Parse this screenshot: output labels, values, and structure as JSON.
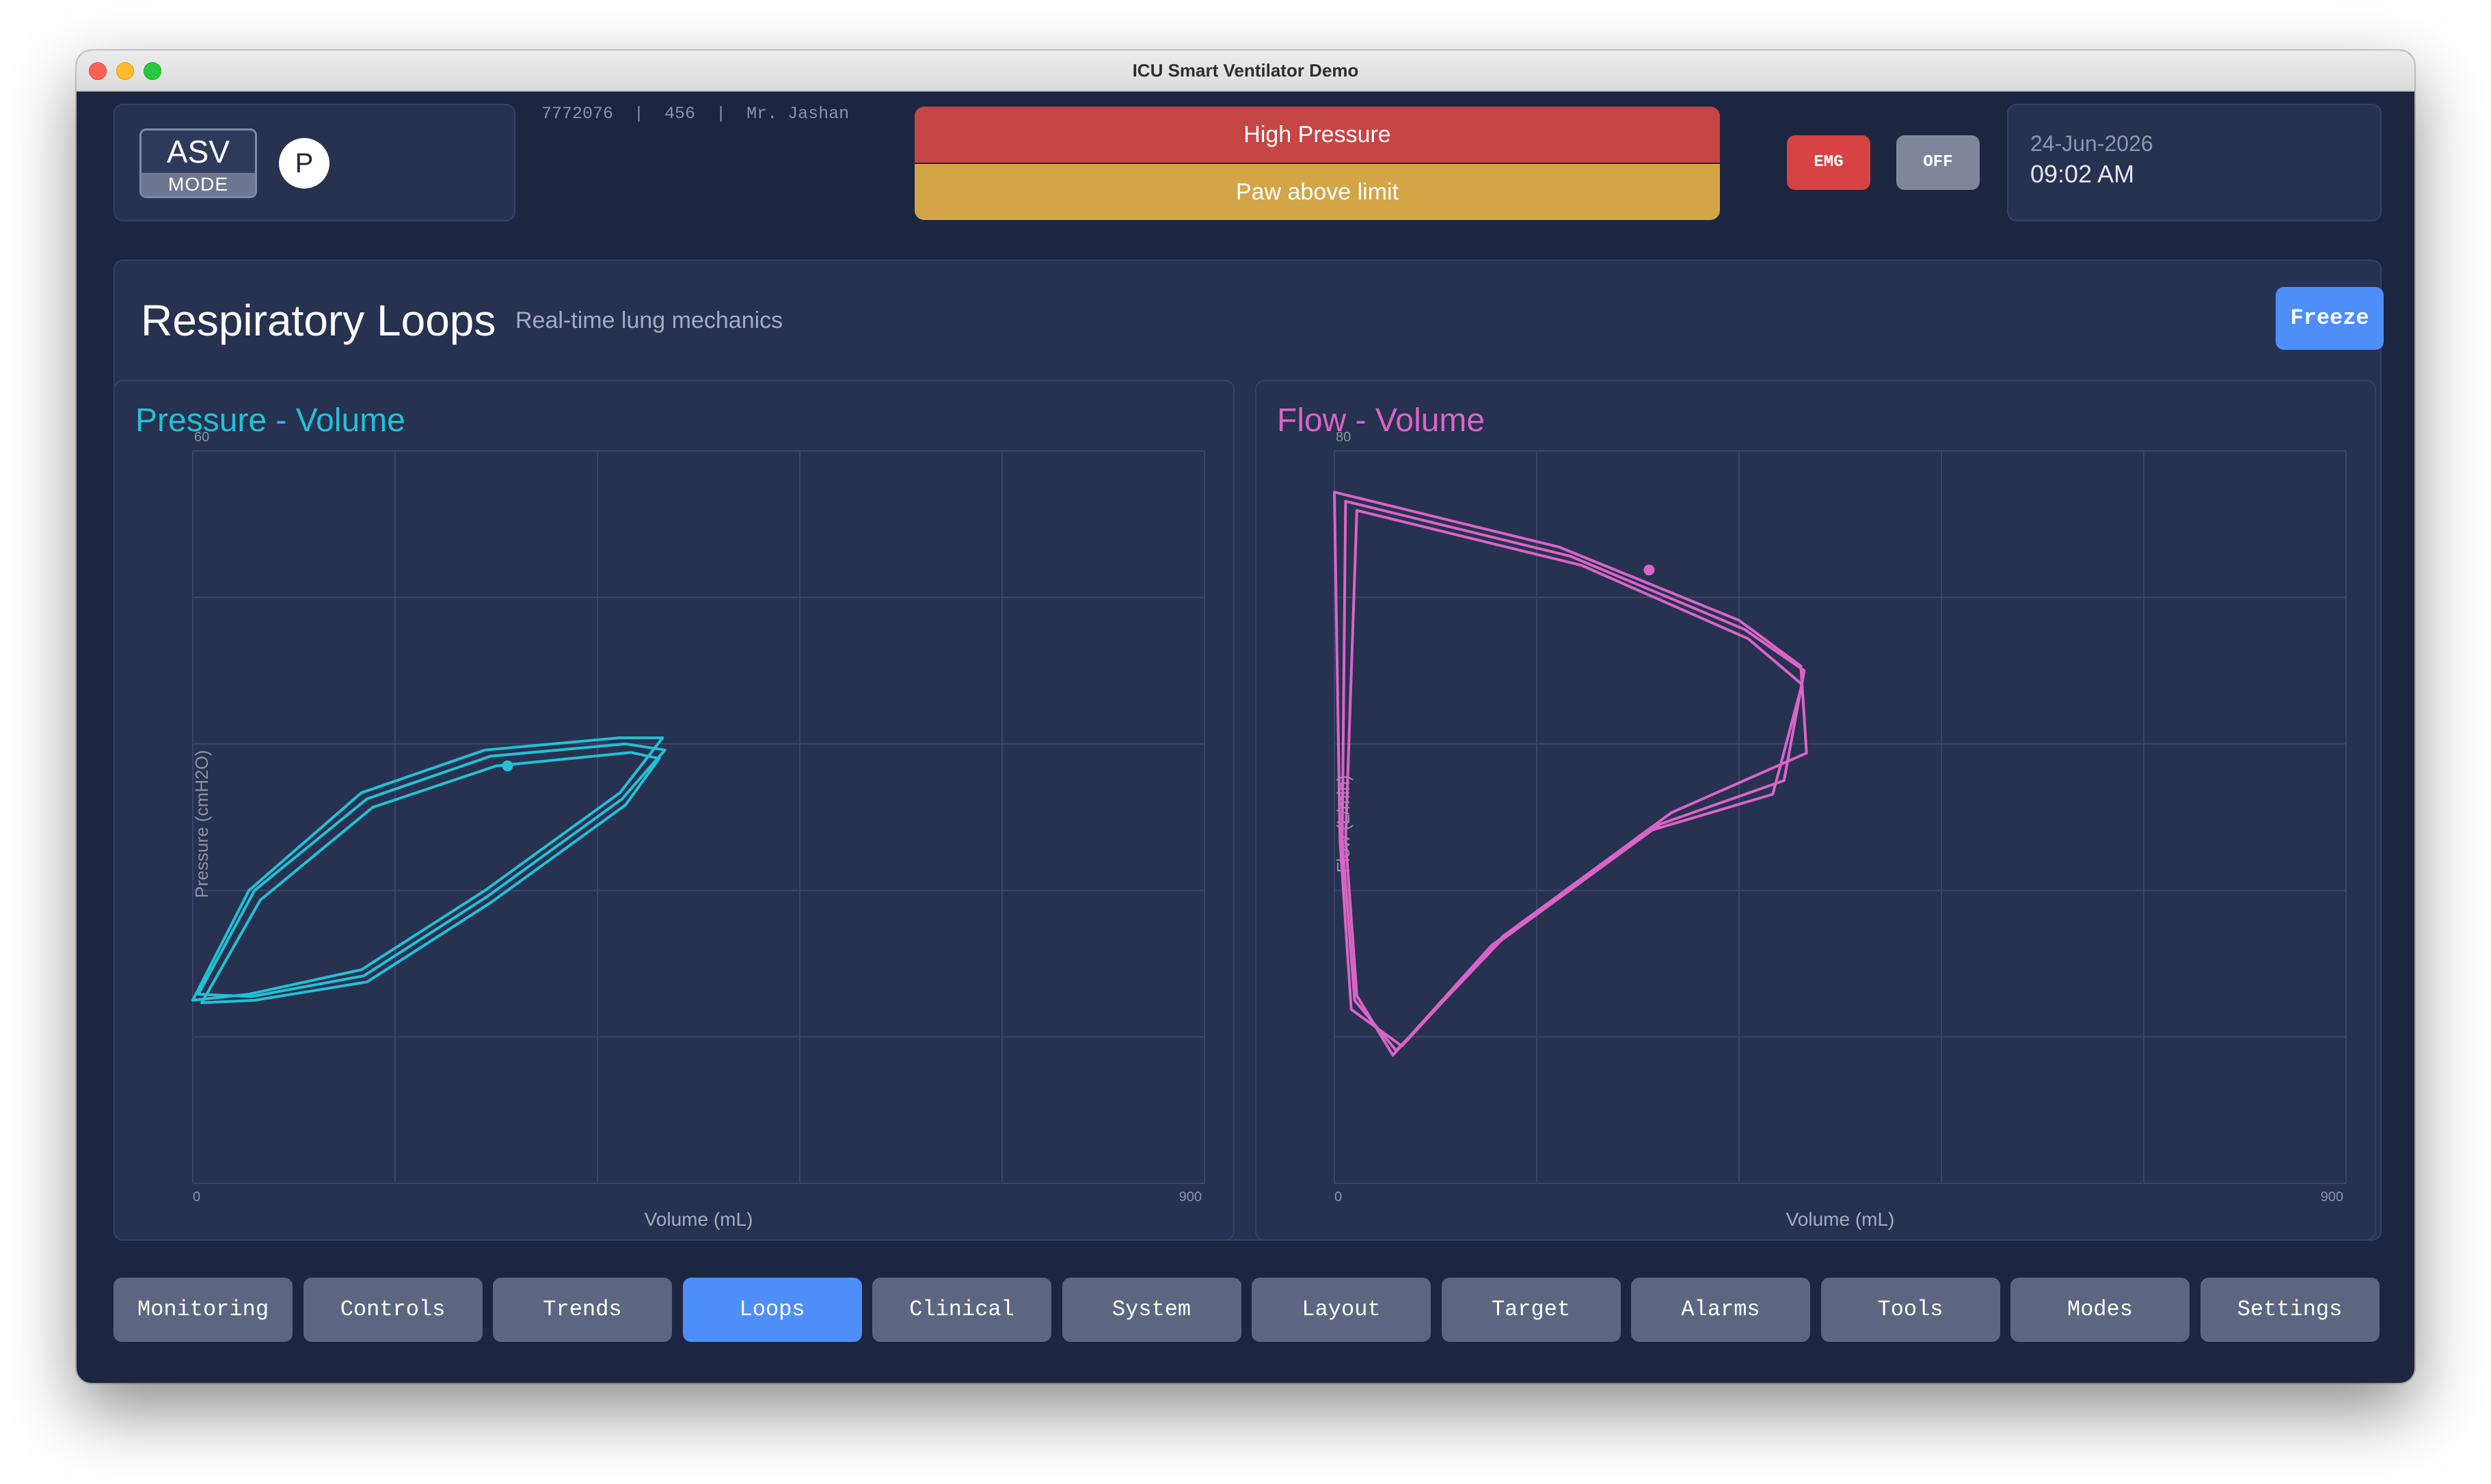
{
  "window": {
    "title": "ICU Smart Ventilator Demo"
  },
  "header": {
    "mode": {
      "name": "ASV",
      "label": "MODE"
    },
    "pressure_indicator": "P",
    "patient": {
      "id": "7772076",
      "bed": "456",
      "name": "Mr. Jashan",
      "separator": "|"
    },
    "alarms": [
      {
        "text": "High Pressure",
        "color": "#c64545"
      },
      {
        "text": "Paw above limit",
        "color": "#d3a546"
      }
    ],
    "emg_label": "EMG",
    "off_label": "OFF",
    "date": "24-Jun-2026",
    "time": "09:02 AM"
  },
  "main": {
    "title": "Respiratory Loops",
    "subtitle": "Real-time lung mechanics",
    "freeze_label": "Freeze"
  },
  "chart_data": [
    {
      "type": "line",
      "title": "Pressure - Volume",
      "color": "#22c1d6",
      "xlabel": "Volume (mL)",
      "ylabel": "Pressure (cmH2O)",
      "xlim": [
        0,
        900
      ],
      "ylim": [
        0,
        60
      ],
      "x_tick_labels": [
        "0",
        "900"
      ],
      "y_tick_labels": [
        "60"
      ],
      "grid": true,
      "series": [
        {
          "x": [
            0,
            50,
            150,
            260,
            380,
            418,
            380,
            260,
            150,
            50,
            0
          ],
          "y": [
            15,
            24,
            32,
            35.5,
            36.5,
            36.5,
            32,
            24,
            17.5,
            15.5,
            15
          ]
        },
        {
          "x": [
            5,
            55,
            155,
            265,
            385,
            420,
            382,
            262,
            152,
            52,
            5
          ],
          "y": [
            15.5,
            24,
            31.5,
            35,
            36,
            35.5,
            31.5,
            23.5,
            17,
            15.3,
            15.5
          ]
        },
        {
          "x": [
            8,
            60,
            160,
            270,
            390,
            415,
            385,
            265,
            155,
            55,
            8
          ],
          "y": [
            14.8,
            23.2,
            30.8,
            34.2,
            35.3,
            34.8,
            31,
            23,
            16.5,
            15,
            14.8
          ]
        }
      ],
      "marker": {
        "x": 280,
        "y": 34.2
      }
    },
    {
      "type": "line",
      "title": "Flow - Volume",
      "color": "#d965c6",
      "xlabel": "Volume (mL)",
      "ylabel": "Flow (L/min)",
      "xlim": [
        0,
        900
      ],
      "ylim": [
        -80,
        80
      ],
      "x_tick_labels": [
        "0",
        "900"
      ],
      "y_tick_labels": [
        "80"
      ],
      "grid": true,
      "series": [
        {
          "x": [
            0,
            200,
            360,
            415,
            420,
            300,
            150,
            60,
            15,
            5,
            0
          ],
          "y": [
            71,
            59,
            43,
            33,
            14,
            1,
            -26,
            -50,
            -42,
            -5,
            71
          ]
        },
        {
          "x": [
            10,
            210,
            365,
            418,
            400,
            290,
            148,
            55,
            18,
            7,
            10
          ],
          "y": [
            69,
            57,
            41,
            32,
            8,
            -1.5,
            -27,
            -51,
            -40,
            -5,
            69
          ]
        },
        {
          "x": [
            20,
            220,
            368,
            416,
            390,
            280,
            140,
            52,
            20,
            10,
            20
          ],
          "y": [
            67,
            55,
            39,
            29,
            5,
            -3,
            -28,
            -52,
            -39,
            -5,
            67
          ]
        }
      ],
      "marker": {
        "x": 280,
        "y": 54
      }
    }
  ],
  "nav": {
    "active": "Loops",
    "tabs": [
      "Monitoring",
      "Controls",
      "Trends",
      "Loops",
      "Clinical",
      "System",
      "Layout",
      "Target",
      "Alarms",
      "Tools",
      "Modes",
      "Settings"
    ]
  },
  "colors": {
    "background": "#1d2641",
    "panel": "#273150",
    "accent": "#4d8ef9",
    "alarm_red": "#c64545",
    "alarm_yellow": "#d3a546"
  }
}
